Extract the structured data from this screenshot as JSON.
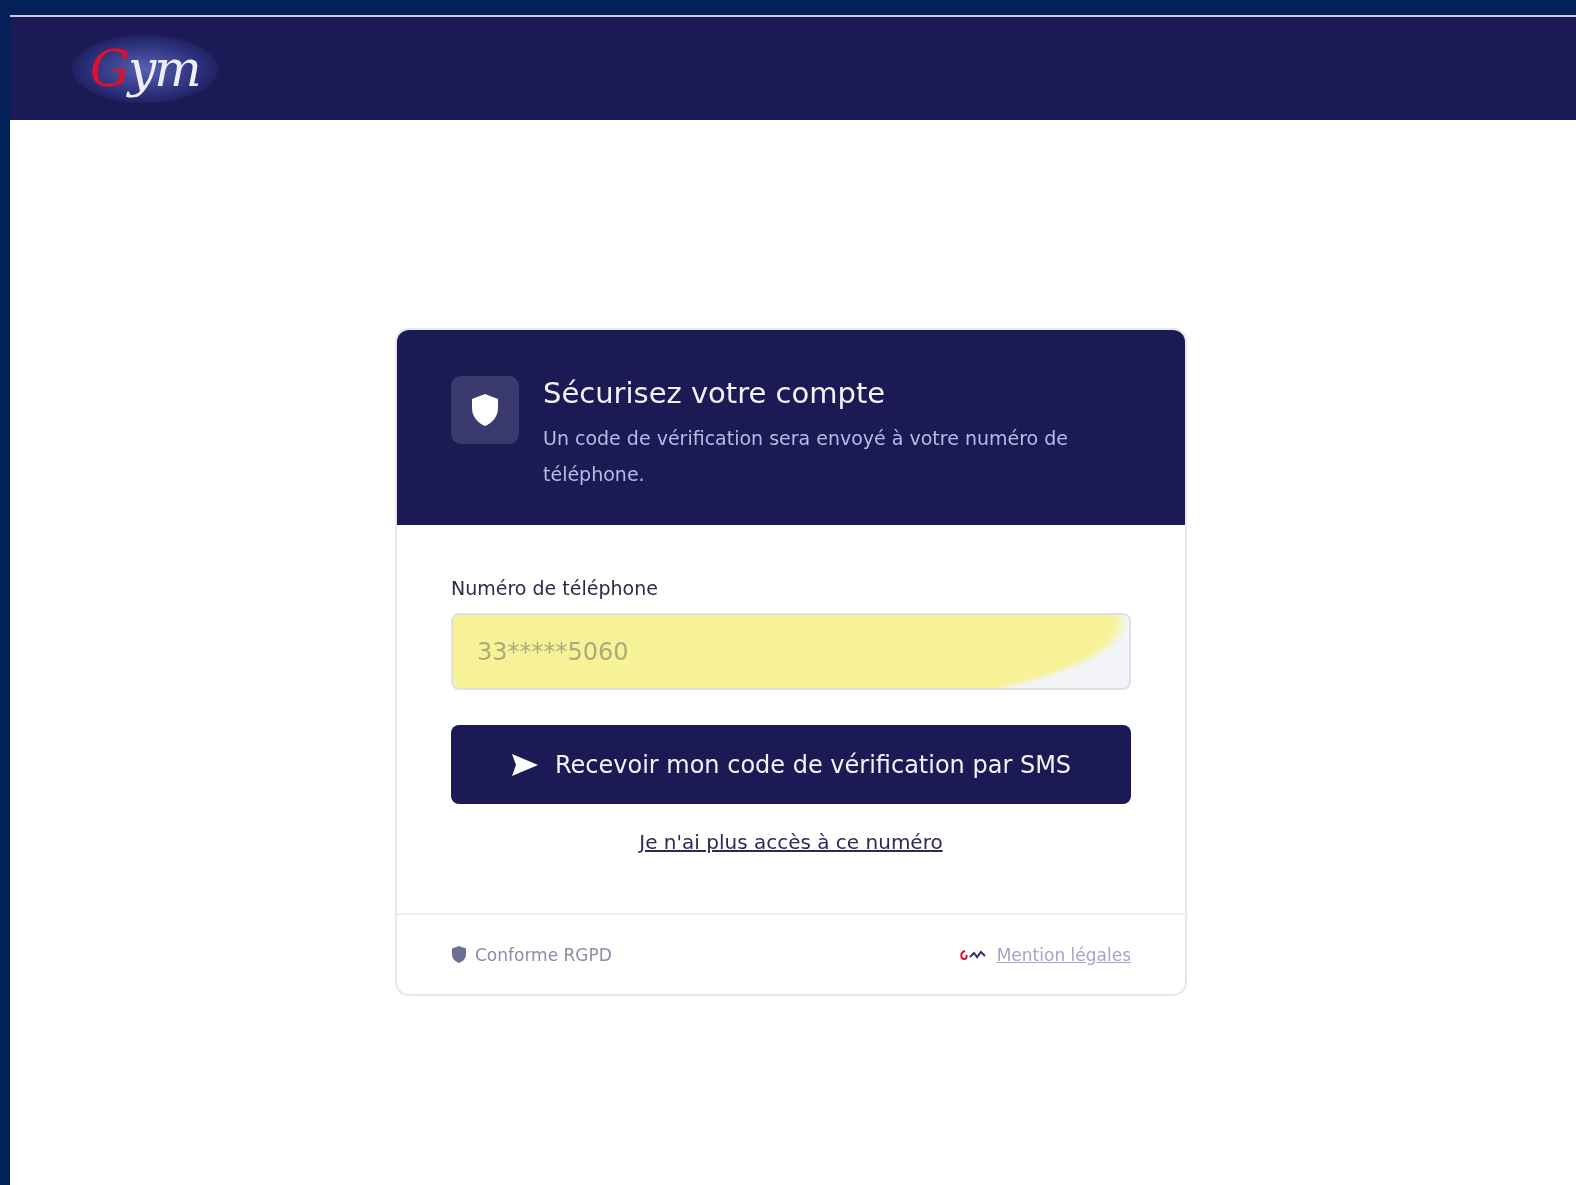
{
  "header": {
    "logo": "Gym"
  },
  "card": {
    "title": "Sécurisez votre compte",
    "subtitle": "Un code de vérification sera envoyé à votre numéro de téléphone.",
    "field": {
      "label": "Numéro de téléphone",
      "value": "33*****5060",
      "highlighted": true
    },
    "button": "Recevoir mon code de vérification par SMS",
    "link": "Je n'ai plus accès à ce numéro",
    "footer": {
      "compliance": "Conforme RGPD",
      "legal_link": "Mention légales"
    }
  }
}
